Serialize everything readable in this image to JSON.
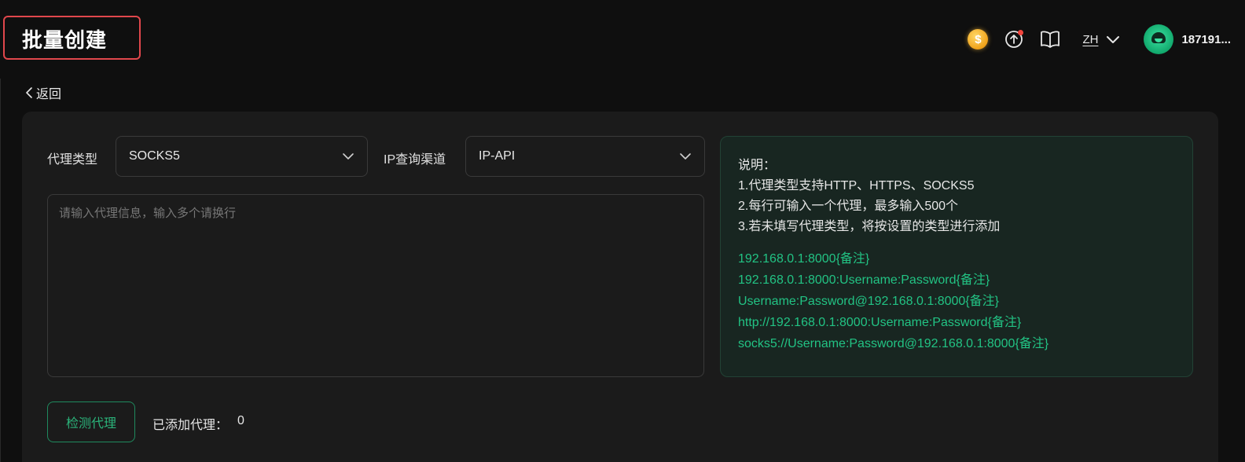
{
  "header": {
    "title": "批量创建",
    "language": "ZH",
    "username": "187191..."
  },
  "nav": {
    "back_label": "返回"
  },
  "form": {
    "proxy_type_label": "代理类型",
    "proxy_type_value": "SOCKS5",
    "ip_channel_label": "IP查询渠道",
    "ip_channel_value": "IP-API",
    "textarea_placeholder": "请输入代理信息，输入多个请换行"
  },
  "info": {
    "title": "说明：",
    "lines": [
      "1.代理类型支持HTTP、HTTPS、SOCKS5",
      "2.每行可输入一个代理，最多输入500个",
      "3.若未填写代理类型，将按设置的类型进行添加"
    ],
    "examples": [
      "192.168.0.1:8000{备注}",
      "192.168.0.1:8000:Username:Password{备注}",
      "Username:Password@192.168.0.1:8000{备注}",
      "http://192.168.0.1:8000:Username:Password{备注}",
      "socks5://Username:Password@192.168.0.1:8000{备注}"
    ]
  },
  "footer": {
    "detect_button": "检测代理",
    "added_label": "已添加代理：",
    "added_count": "0"
  },
  "colors": {
    "accent": "#22c384",
    "highlight_border": "#e0474c",
    "background": "#0f0f0f",
    "card": "#1b1b1b"
  },
  "icons": [
    "coin-icon",
    "upload-icon",
    "book-icon",
    "chevron-down-icon",
    "chevron-left-icon",
    "avatar"
  ]
}
